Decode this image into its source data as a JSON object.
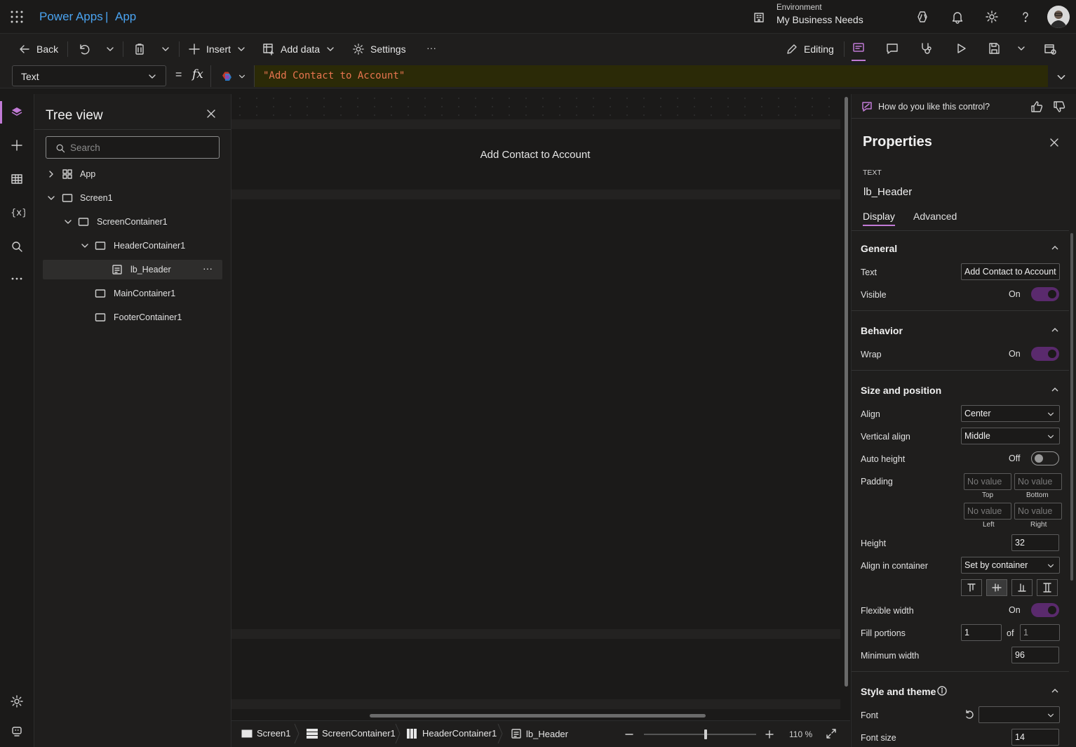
{
  "topbar": {
    "product": "Power Apps",
    "separator": "|",
    "app_name": "App",
    "environment_label": "Environment",
    "environment_name": "My Business Needs"
  },
  "toolbar": {
    "back": "Back",
    "insert": "Insert",
    "add_data": "Add data",
    "settings": "Settings",
    "more": "···",
    "editing": "Editing"
  },
  "formula": {
    "property": "Text",
    "equals": "=",
    "fx": "fx",
    "value": "\"Add Contact to Account\""
  },
  "tree": {
    "title": "Tree view",
    "search_placeholder": "Search",
    "items": [
      {
        "label": "App"
      },
      {
        "label": "Screen1"
      },
      {
        "label": "ScreenContainer1"
      },
      {
        "label": "HeaderContainer1"
      },
      {
        "label": "lb_Header"
      },
      {
        "label": "MainContainer1"
      },
      {
        "label": "FooterContainer1"
      }
    ],
    "row_more": "···"
  },
  "canvas": {
    "header_text": "Add Contact to Account"
  },
  "status": {
    "crumbs": [
      "Screen1",
      "ScreenContainer1",
      "HeaderContainer1",
      "lb_Header"
    ],
    "zoom": "110 %",
    "zoom_fraction": 0.55
  },
  "props": {
    "feedback": "How do you like this control?",
    "title": "Properties",
    "control_type": "TEXT",
    "control_name": "lb_Header",
    "tabs": [
      "Display",
      "Advanced"
    ],
    "general": {
      "title": "General",
      "text_label": "Text",
      "text_value": "Add Contact to Account",
      "visible_label": "Visible",
      "visible_state": "On"
    },
    "behavior": {
      "title": "Behavior",
      "wrap_label": "Wrap",
      "wrap_state": "On"
    },
    "size": {
      "title": "Size and position",
      "align_label": "Align",
      "align_value": "Center",
      "valign_label": "Vertical align",
      "valign_value": "Middle",
      "autoheight_label": "Auto height",
      "autoheight_state": "Off",
      "padding_label": "Padding",
      "padding_placeholder": "No value",
      "pad_top": "Top",
      "pad_bottom": "Bottom",
      "pad_left": "Left",
      "pad_right": "Right",
      "height_label": "Height",
      "height_value": "32",
      "aic_label": "Align in container",
      "aic_value": "Set by container",
      "flexwidth_label": "Flexible width",
      "flexwidth_state": "On",
      "fill_label": "Fill portions",
      "fill_value": "1",
      "fill_of": "of",
      "fill_total": "1",
      "minwidth_label": "Minimum width",
      "minwidth_value": "96"
    },
    "style": {
      "title": "Style and theme",
      "font_label": "Font",
      "font_value": "",
      "fontsize_label": "Font size",
      "fontsize_value": "14"
    }
  },
  "colors": {
    "accent": "#c17ad6",
    "brand": "#4aa3f0",
    "toggle_on": "#5a2a6d",
    "formula_string": "#e8754f"
  }
}
